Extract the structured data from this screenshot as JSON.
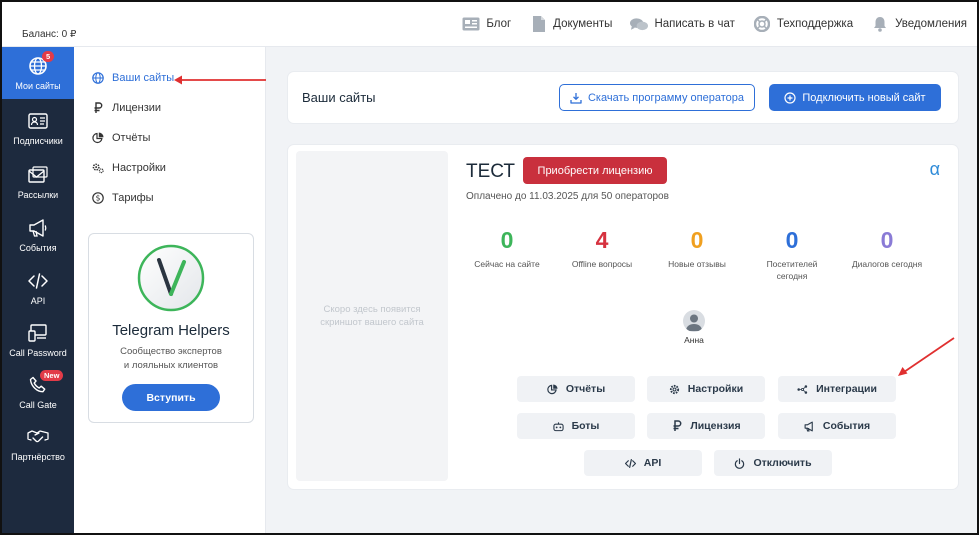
{
  "topbar": {
    "balance": "Баланс: 0 ₽",
    "nav": [
      {
        "label": "Блог",
        "icon": "blog-icon"
      },
      {
        "label": "Документы",
        "icon": "document-icon"
      },
      {
        "label": "Написать в чат",
        "icon": "chat-icon"
      },
      {
        "label": "Техподдержка",
        "icon": "lifebuoy-icon"
      },
      {
        "label": "Уведомления",
        "icon": "bell-icon"
      }
    ]
  },
  "sidebar": {
    "items": [
      {
        "label": "Мои сайты",
        "icon": "globe-icon",
        "badge": "5",
        "active": true
      },
      {
        "label": "Подписчики",
        "icon": "contact-card-icon"
      },
      {
        "label": "Рассылки",
        "icon": "mail-icon"
      },
      {
        "label": "События",
        "icon": "megaphone-icon"
      },
      {
        "label": "API",
        "icon": "code-icon"
      },
      {
        "label": "Call Password",
        "icon": "devices-icon"
      },
      {
        "label": "Call Gate",
        "icon": "phone-icon",
        "badge": "New"
      },
      {
        "label": "Партнёрство",
        "icon": "handshake-icon"
      }
    ]
  },
  "subnav": {
    "items": [
      {
        "label": "Ваши сайты",
        "icon": "globe-icon",
        "active": true
      },
      {
        "label": "Лицензии",
        "icon": "ruble-icon"
      },
      {
        "label": "Отчёты",
        "icon": "pie-chart-icon"
      },
      {
        "label": "Настройки",
        "icon": "gears-icon"
      },
      {
        "label": "Тарифы",
        "icon": "dollar-circle-icon"
      }
    ],
    "promo": {
      "title": "Telegram Helpers",
      "subtitle_line1": "Сообщество экспертов",
      "subtitle_line2": "и лояльных клиентов",
      "button": "Вступить"
    }
  },
  "header": {
    "title": "Ваши сайты",
    "download_button": "Скачать программу оператора",
    "connect_button": "Подключить новый сайт"
  },
  "site": {
    "screenshot_placeholder": "Скоро здесь появится скриншот вашего сайта",
    "name": "ТЕСТ",
    "license_button": "Приобрести лицензию",
    "brand_glyph": "α",
    "paid_until": "Оплачено до 11.03.2025 для 50 операторов",
    "stats": [
      {
        "value": "0",
        "label": "Сейчас на сайте",
        "color": "#3db55a"
      },
      {
        "value": "4",
        "label": "Offline вопросы",
        "color": "#d6323f"
      },
      {
        "value": "0",
        "label": "Новые отзывы",
        "color": "#f0a020"
      },
      {
        "value": "0",
        "label": "Посетителей сегодня",
        "color": "#2e6fd8"
      },
      {
        "value": "0",
        "label": "Диалогов сегодня",
        "color": "#8a7bd6"
      }
    ],
    "operator": {
      "name": "Анна"
    },
    "actions": [
      {
        "label": "Отчёты",
        "icon": "pie-chart-icon"
      },
      {
        "label": "Настройки",
        "icon": "gear-icon"
      },
      {
        "label": "Интеграции",
        "icon": "integrations-icon"
      },
      {
        "label": "Боты",
        "icon": "bot-icon"
      },
      {
        "label": "Лицензия",
        "icon": "ruble-icon"
      },
      {
        "label": "События",
        "icon": "megaphone-icon"
      },
      {
        "label": "API",
        "icon": "code-icon"
      },
      {
        "label": "Отключить",
        "icon": "power-icon"
      }
    ]
  },
  "colors": {
    "primary": "#2e6fd8",
    "sidebar": "#1d2a3e",
    "danger": "#c9303d",
    "annotation_arrow": "#e03030"
  }
}
